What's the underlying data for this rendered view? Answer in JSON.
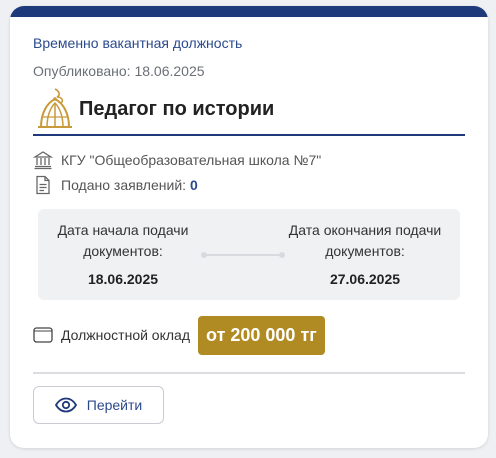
{
  "vacancy": {
    "type_label": "Временно вакантная должность",
    "published_label": "Опубликовано:",
    "published_date": "18.06.2025",
    "title": "Педагог по истории",
    "organization": "КГУ \"Общеобразовательная школа №7\"",
    "applications_label": "Подано заявлений:",
    "applications_count": "0",
    "start": {
      "label_line1": "Дата начала подачи",
      "label_line2": "документов:",
      "date": "18.06.2025"
    },
    "end": {
      "label_line1": "Дата окончания подачи",
      "label_line2": "документов:",
      "date": "27.06.2025"
    },
    "salary_label": "Должностной оклад",
    "salary_value": "от 200 000 тг",
    "button_label": "Перейти"
  },
  "icons": {
    "emblem": "emblem-icon",
    "organization": "bank-icon",
    "applications": "document-icon",
    "salary": "wallet-icon",
    "button": "eye-icon"
  },
  "colors": {
    "accent": "#1f3a7a",
    "link": "#2b4a8c",
    "salary_badge": "#b08a22"
  }
}
